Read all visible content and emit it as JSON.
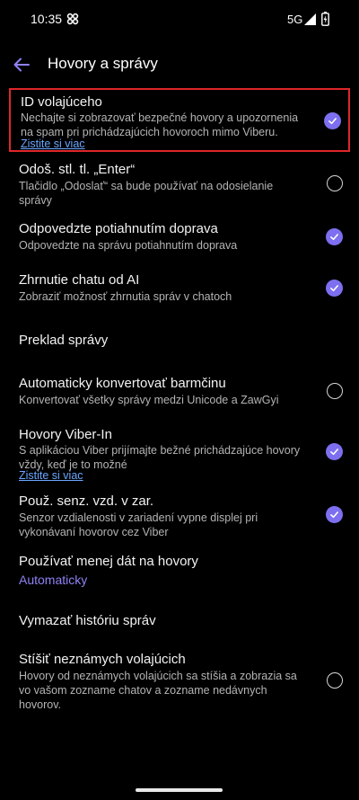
{
  "status_bar": {
    "time": "10:35",
    "network": "5G",
    "app_icon": "pinwheel-icon",
    "signal_icon": "signal-icon",
    "battery_icon": "battery-charging-icon"
  },
  "header": {
    "title": "Hovory a správy",
    "back_icon": "back-arrow-icon"
  },
  "colors": {
    "background": "#000000",
    "accent": "#7d6ff0",
    "link": "#6aa6ff",
    "highlight_border": "#e0262a"
  },
  "settings": [
    {
      "title": "ID volajúceho",
      "description": "Nechajte si zobrazovať bezpečné hovory a upozornenia na spam pri prichádzajúcich hovoroch mimo Viberu.",
      "link": "Zistite si viac",
      "checked": true
    },
    {
      "title": "Odoš. stl. tl. „Enter“",
      "description": "Tlačidlo „Odoslať“ sa bude používať na odosielanie správy",
      "checked": false
    },
    {
      "title": "Odpovedzte potiahnutím doprava",
      "description": "Odpovedzte na správu potiahnutím doprava",
      "checked": true
    },
    {
      "title": "Zhrnutie chatu od AI",
      "description": "Zobraziť možnosť zhrnutia správ v chatoch",
      "checked": true
    },
    {
      "title": "Preklad správy"
    },
    {
      "title": "Automaticky konvertovať barmčinu",
      "description": "Konvertovať všetky správy medzi Unicode a ZawGyi",
      "checked": false
    },
    {
      "title": "Hovory Viber-In",
      "description": "S aplikáciou Viber prijímajte bežné prichádzajúce hovory vždy, keď je to možné",
      "link": "Zistite si viac",
      "checked": true
    },
    {
      "title": "Použ. senz. vzd. v zar.",
      "description": "Senzor vzdialenosti v zariadení vypne displej pri vykonávaní hovorov cez Viber",
      "checked": true
    },
    {
      "title": "Používať menej dát na hovory",
      "value": "Automaticky"
    },
    {
      "title": "Vymazať históriu správ"
    },
    {
      "title": "Stíšiť neznámych volajúcich",
      "description": "Hovory od neznámych volajúcich sa stíšia a zobrazia sa vo vašom zozname chatov a zozname nedávnych hovorov.",
      "checked": false
    }
  ]
}
